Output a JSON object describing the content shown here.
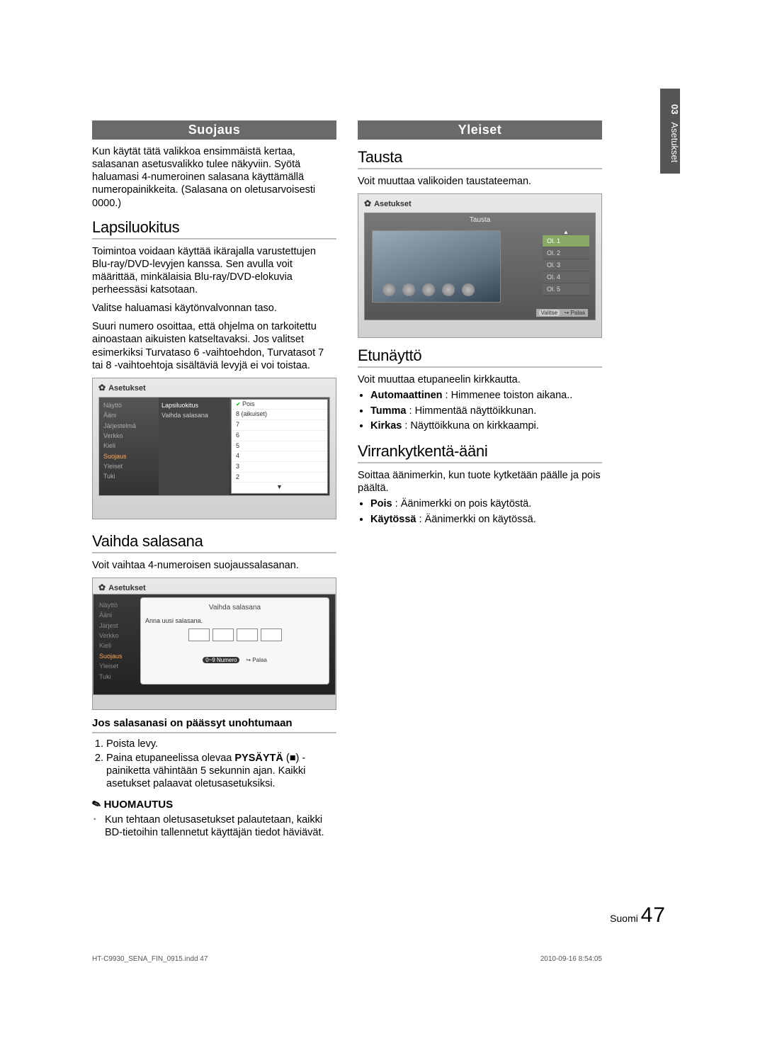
{
  "sidetab": {
    "num": "03",
    "label": "Asetukset"
  },
  "left": {
    "section_bar": "Suojaus",
    "intro": "Kun käytät tätä valikkoa ensimmäistä kertaa, salasanan asetusvalikko tulee näkyviin. Syötä haluamasi 4-numeroinen salasana käyttämällä numeropainikkeita. (Salasana on oletusarvoisesti 0000.)",
    "h_lapsiluokitus": "Lapsiluokitus",
    "lapsiluokitus_p1": "Toimintoa voidaan käyttää ikärajalla varustettujen Blu-ray/DVD-levyjen kanssa. Sen avulla voit määrittää, minkälaisia Blu-ray/DVD-elokuvia perheessäsi katsotaan.",
    "lapsiluokitus_p2": "Valitse haluamasi käytönvalvonnan taso.",
    "lapsiluokitus_p3": "Suuri numero osoittaa, että ohjelma on tarkoitettu ainoastaan aikuisten katseltavaksi. Jos valitset esimerkiksi Turvataso 6 -vaihtoehdon, Turvatasot 7 tai 8 -vaihtoehtoja sisältäviä levyjä ei voi toistaa.",
    "shot1": {
      "title": "Asetukset",
      "nav": [
        "Näyttö",
        "Ääni",
        "Järjestelmä",
        "Verkko",
        "Kieli",
        "Suojaus",
        "Yleiset",
        "Tuki"
      ],
      "mid": [
        "Lapsiluokitus",
        "Vaihda salasana"
      ],
      "opts": [
        "Pois",
        "8 (aikuiset)",
        "7",
        "6",
        "5",
        "4",
        "3",
        "2"
      ]
    },
    "h_vaihda": "Vaihda salasana",
    "vaihda_p1": "Voit vaihtaa 4-numeroisen suojaussalasanan.",
    "shot2": {
      "title": "Asetukset",
      "nav": [
        "Näyttö",
        "Ääni",
        "Järjest",
        "Verkko",
        "Kieli",
        "Suojaus",
        "Yleiset",
        "Tuki"
      ],
      "panel_title": "Vaihda salasana",
      "sub": "Anna uusi salasana.",
      "btn_num": "0~9 Numero",
      "btn_ret": "↪ Palaa"
    },
    "h_unohtunut": "Jos salasanasi on päässyt unohtumaan",
    "step1": "Poista levy.",
    "step2a": "Paina etupaneelissa olevaa ",
    "step2b": "PYSÄYTÄ",
    "step2c": " (■) - painiketta vähintään 5 sekunnin ajan. Kaikki asetukset palaavat oletusasetuksiksi.",
    "note_label": "HUOMAUTUS",
    "note_body": "Kun tehtaan oletusasetukset palautetaan, kaikki BD-tietoihin tallennetut käyttäjän tiedot häviävät."
  },
  "right": {
    "section_bar": "Yleiset",
    "h_tausta": "Tausta",
    "tausta_p": "Voit muuttaa valikoiden taustateeman.",
    "shot3": {
      "title": "Asetukset",
      "panel_title": "Tausta",
      "opts": [
        "Ol. 1",
        "Ol. 2",
        "Ol. 3",
        "Ol. 4",
        "Ol. 5"
      ],
      "move": "▲",
      "select": "Valitse",
      "return": "↪ Palaa"
    },
    "h_etunaytto": "Etunäyttö",
    "etun_p": "Voit muuttaa etupaneelin kirkkautta.",
    "etun_b1a": "Automaattinen",
    "etun_b1b": " : Himmenee toiston aikana..",
    "etun_b2a": "Tumma",
    "etun_b2b": " : Himmentää näyttöikkunan.",
    "etun_b3a": "Kirkas",
    "etun_b3b": " : Näyttöikkuna on kirkkaampi.",
    "h_virta": "Virrankytkentä-ääni",
    "virta_p": "Soittaa äänimerkin, kun tuote kytketään päälle ja pois päältä.",
    "virta_b1a": "Pois",
    "virta_b1b": " : Äänimerkki on pois käytöstä.",
    "virta_b2a": "Käytössä",
    "virta_b2b": " : Äänimerkki on käytössä."
  },
  "footer": {
    "lang": "Suomi",
    "page": "47"
  },
  "printfoot": {
    "left": "HT-C9930_SENA_FIN_0915.indd   47",
    "right": "2010-09-16     8:54:05"
  }
}
